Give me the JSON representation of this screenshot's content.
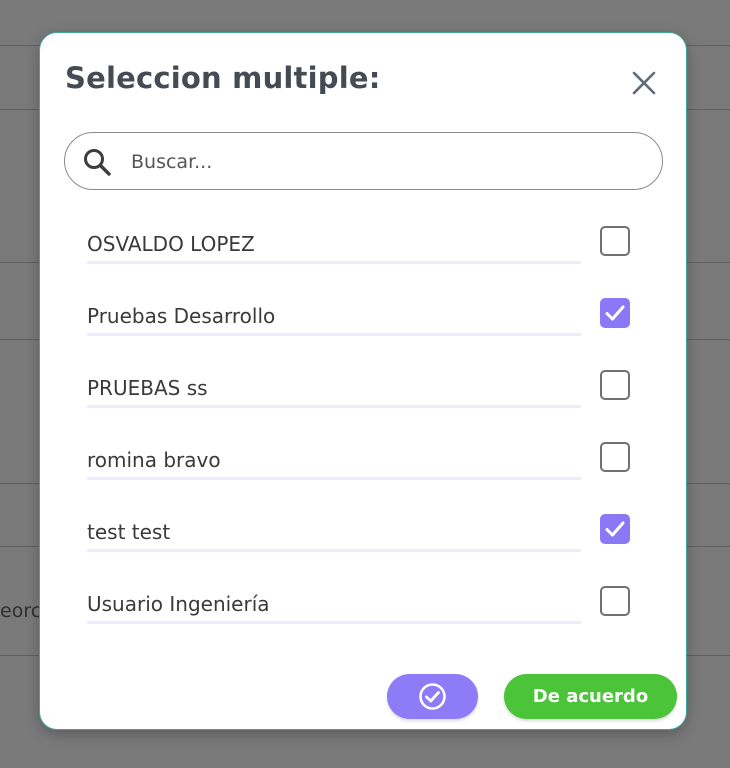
{
  "background": {
    "partial_text": "eorc"
  },
  "modal": {
    "title": "Seleccion multiple:",
    "close_icon": "close-icon",
    "search": {
      "placeholder": "Buscar...",
      "value": "",
      "icon": "search-icon"
    },
    "items": [
      {
        "label": "OSVALDO LOPEZ",
        "checked": false
      },
      {
        "label": "Pruebas Desarrollo",
        "checked": true
      },
      {
        "label": "PRUEBAS ss",
        "checked": false
      },
      {
        "label": "romina bravo",
        "checked": false
      },
      {
        "label": "test test",
        "checked": true
      },
      {
        "label": "Usuario Ingeniería",
        "checked": false
      }
    ],
    "footer": {
      "confirm_icon": "check-circle-icon",
      "agree_label": "De acuerdo"
    }
  },
  "colors": {
    "overlay": "#7a7a7a",
    "accent_purple": "#8b78f6",
    "agree_green": "#4bc43a",
    "modal_border": "#3fa89a",
    "title": "#444b55"
  }
}
